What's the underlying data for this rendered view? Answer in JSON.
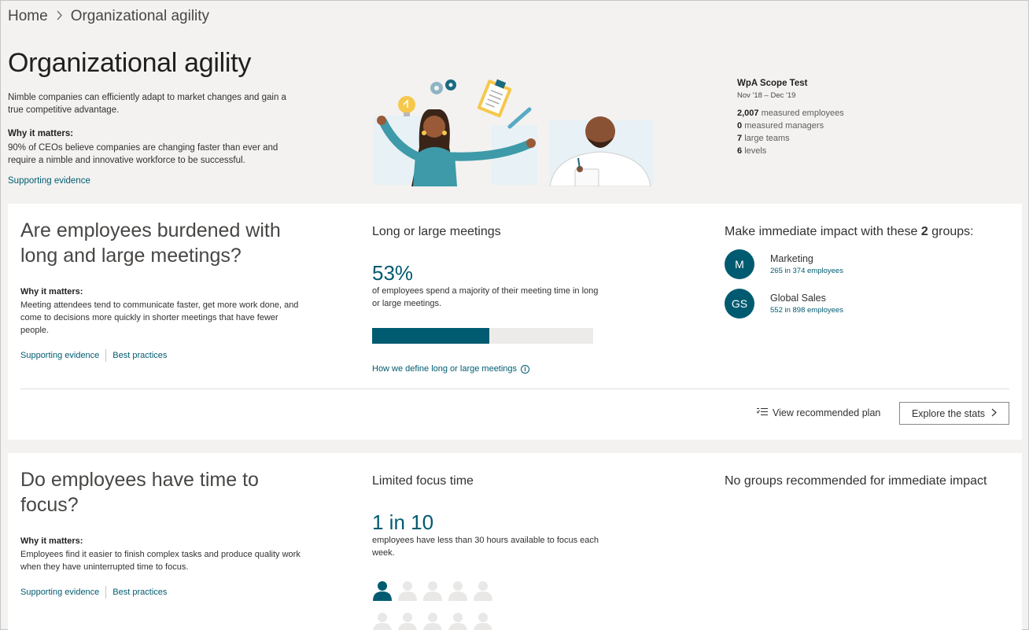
{
  "breadcrumb": {
    "home": "Home",
    "current": "Organizational agility"
  },
  "hero": {
    "title": "Organizational agility",
    "intro": "Nimble companies can efficiently adapt to market changes and gain a true competitive advantage.",
    "why_label": "Why it matters:",
    "why_text": "90% of CEOs believe companies are changing faster than ever and require a nimble and innovative workforce to be successful.",
    "evidence_link": "Supporting evidence"
  },
  "scope": {
    "name": "WpA Scope Test",
    "dates": "Nov '18 – Dec '19",
    "stats": [
      {
        "value": "2,007",
        "label": "measured employees"
      },
      {
        "value": "0",
        "label": "measured managers"
      },
      {
        "value": "7",
        "label": "large teams"
      },
      {
        "value": "6",
        "label": "levels"
      }
    ]
  },
  "cards": [
    {
      "question": "Are employees burdened with long and large meetings?",
      "why_label": "Why it matters:",
      "why_text": "Meeting attendees tend to communicate faster, get more work done, and come to decisions more quickly in shorter meetings that have fewer people.",
      "link_evidence": "Supporting evidence",
      "link_practices": "Best practices",
      "metric_title": "Long or large meetings",
      "metric_value": "53%",
      "metric_fraction": 0.53,
      "metric_desc": "of employees spend a majority of their meeting time in long or large meetings.",
      "define_link": "How we define long or large meetings",
      "impact_prefix": "Make immediate impact with these",
      "impact_count": "2",
      "impact_suffix": "groups:",
      "groups": [
        {
          "initials": "M",
          "name": "Marketing",
          "count": "265 in 374 employees"
        },
        {
          "initials": "GS",
          "name": "Global Sales",
          "count": "552 in 898 employees"
        }
      ],
      "view_plan": "View recommended plan",
      "explore": "Explore the stats"
    },
    {
      "question": "Do employees have time to focus?",
      "why_label": "Why it matters:",
      "why_text": "Employees find it easier to finish complex tasks and produce quality work when they have uninterrupted time to focus.",
      "link_evidence": "Supporting evidence",
      "link_practices": "Best practices",
      "metric_title": "Limited focus time",
      "metric_value": "1 in 10",
      "metric_desc": "employees have less than 30 hours available to focus each week.",
      "people_highlighted": 1,
      "people_total": 10,
      "impact_none": "No groups recommended for immediate impact"
    }
  ],
  "colors": {
    "accent": "#005b70",
    "progress_track": "#edebe9",
    "person_inactive": "#e9e8e7"
  },
  "icons": {
    "breadcrumb_separator": "chevron-right-icon",
    "plan": "list-icon",
    "explore": "chevron-right-icon",
    "info": "info-icon",
    "person": "person-icon"
  }
}
